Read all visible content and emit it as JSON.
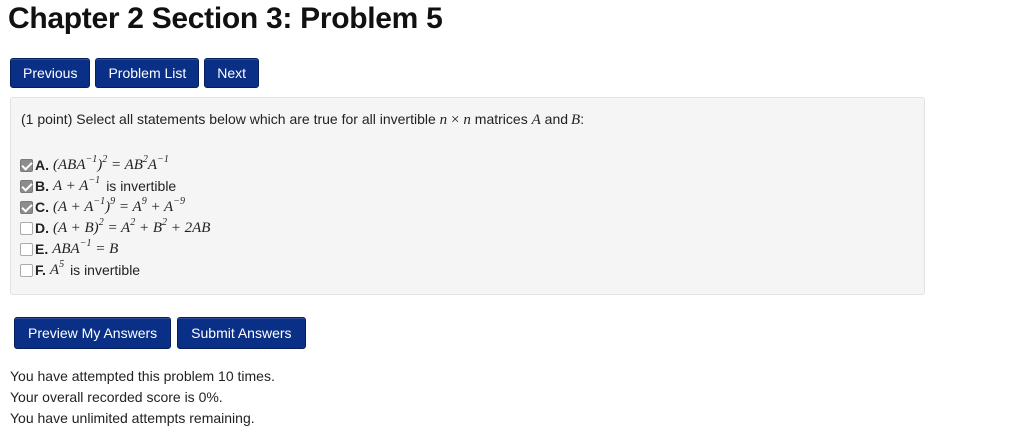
{
  "title": "Chapter 2 Section 3: Problem 5",
  "nav": {
    "previous": "Previous",
    "problem_list": "Problem List",
    "next": "Next"
  },
  "problem": {
    "points": "(1 point)",
    "prompt_start": "Select all statements below which are true for all invertible",
    "n": "n",
    "times": "×",
    "n2": "n",
    "matrices": "matrices",
    "A": "A",
    "and": "and",
    "B": "B",
    "colon": ":"
  },
  "choices": [
    {
      "letter": "A.",
      "checked": true
    },
    {
      "letter": "B.",
      "checked": true,
      "text": "is invertible"
    },
    {
      "letter": "C.",
      "checked": true
    },
    {
      "letter": "D.",
      "checked": false
    },
    {
      "letter": "E.",
      "checked": false
    },
    {
      "letter": "F.",
      "checked": false,
      "text": "is invertible"
    }
  ],
  "actions": {
    "preview": "Preview My Answers",
    "submit": "Submit Answers"
  },
  "status": {
    "attempts": "You have attempted this problem 10 times.",
    "score": "Your overall recorded score is 0%.",
    "remaining": "You have unlimited attempts remaining."
  },
  "colors": {
    "button": "#0a2f86",
    "panel": "#f5f5f5"
  }
}
